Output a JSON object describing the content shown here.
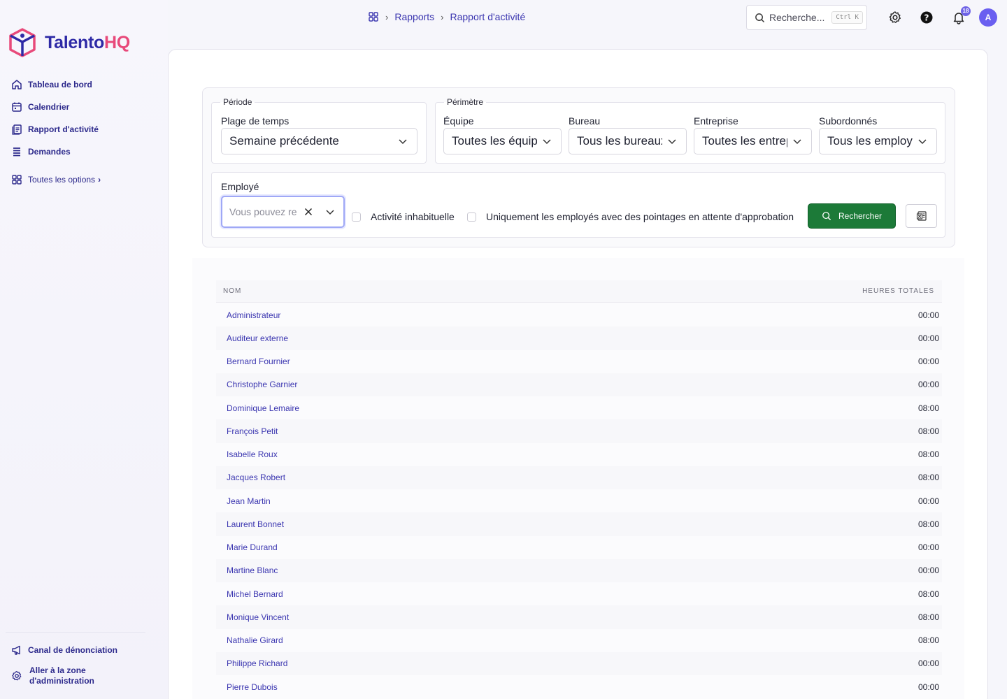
{
  "brand": {
    "name_part1": "Talento",
    "name_part2": "HQ",
    "colors": {
      "primary": "#2e2aa6",
      "accent": "#e8497a"
    }
  },
  "sidebar": {
    "items": [
      {
        "label": "Tableau de bord",
        "icon": "home-icon"
      },
      {
        "label": "Calendrier",
        "icon": "calendar-icon"
      },
      {
        "label": "Rapport d'activité",
        "icon": "report-icon"
      },
      {
        "label": "Demandes",
        "icon": "list-icon"
      },
      {
        "label": "Toutes les options",
        "icon": "grid-icon",
        "suffix": "›"
      }
    ],
    "bottom": [
      {
        "label": "Canal de dénonciation",
        "icon": "megaphone-icon"
      },
      {
        "label": "Aller à la zone d'administration",
        "icon": "gear-icon"
      }
    ]
  },
  "header": {
    "breadcrumb": [
      "Rapports",
      "Rapport d'activité"
    ],
    "search_placeholder": "Recherche...",
    "search_shortcut": "Ctrl K",
    "notification_count": "18",
    "avatar_initial": "A"
  },
  "filters": {
    "periode": {
      "legend": "Période",
      "plage_label": "Plage de temps",
      "plage_value": "Semaine précédente"
    },
    "perimetre": {
      "legend": "Périmètre",
      "equipe_label": "Équipe",
      "equipe_value": "Toutes les équipes",
      "bureau_label": "Bureau",
      "bureau_value": "Tous les bureaux",
      "entreprise_label": "Entreprise",
      "entreprise_value": "Toutes les entreprises",
      "subordonnes_label": "Subordonnés",
      "subordonnes_value": "Tous les employés"
    },
    "employe": {
      "label": "Employé",
      "placeholder": "Vous pouvez rechercher",
      "cb_unusual": "Activité inhabituelle",
      "cb_pending": "Uniquement les employés avec des pointages en attente d'approbation",
      "search_button": "Rechercher"
    }
  },
  "table": {
    "columns": [
      "NOM",
      "HEURES TOTALES"
    ],
    "rows": [
      {
        "name": "Administrateur",
        "hours": "00:00"
      },
      {
        "name": "Auditeur externe",
        "hours": "00:00"
      },
      {
        "name": "Bernard Fournier",
        "hours": "00:00"
      },
      {
        "name": "Christophe Garnier",
        "hours": "00:00"
      },
      {
        "name": "Dominique Lemaire",
        "hours": "08:00"
      },
      {
        "name": "François Petit",
        "hours": "08:00"
      },
      {
        "name": "Isabelle Roux",
        "hours": "08:00"
      },
      {
        "name": "Jacques Robert",
        "hours": "08:00"
      },
      {
        "name": "Jean Martin",
        "hours": "00:00"
      },
      {
        "name": "Laurent Bonnet",
        "hours": "08:00"
      },
      {
        "name": "Marie Durand",
        "hours": "00:00"
      },
      {
        "name": "Martine Blanc",
        "hours": "00:00"
      },
      {
        "name": "Michel Bernard",
        "hours": "08:00"
      },
      {
        "name": "Monique Vincent",
        "hours": "08:00"
      },
      {
        "name": "Nathalie Girard",
        "hours": "08:00"
      },
      {
        "name": "Philippe Richard",
        "hours": "00:00"
      },
      {
        "name": "Pierre Dubois",
        "hours": "00:00"
      }
    ]
  }
}
